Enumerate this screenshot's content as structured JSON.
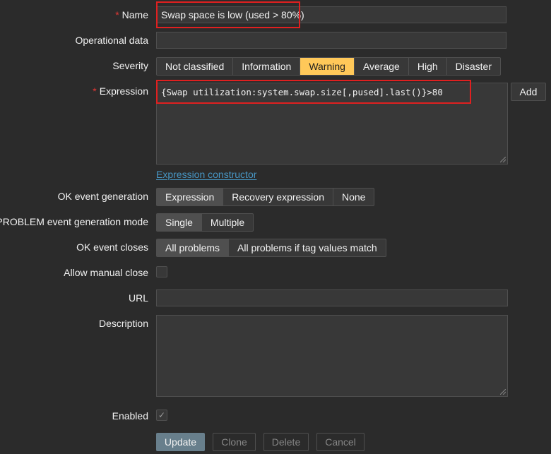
{
  "form": {
    "name": {
      "label": "Name",
      "required": "*",
      "value": "Swap space is low (used > 80%)"
    },
    "operational_data": {
      "label": "Operational data",
      "value": ""
    },
    "severity": {
      "label": "Severity",
      "options": [
        "Not classified",
        "Information",
        "Warning",
        "Average",
        "High",
        "Disaster"
      ],
      "selected": "Warning"
    },
    "expression": {
      "label": "Expression",
      "required": "*",
      "value": "{Swap utilization:system.swap.size[,pused].last()}>80",
      "add_label": "Add",
      "constructor_link": "Expression constructor"
    },
    "ok_event_generation": {
      "label": "OK event generation",
      "options": [
        "Expression",
        "Recovery expression",
        "None"
      ],
      "selected": "Expression"
    },
    "problem_mode": {
      "label": "PROBLEM event generation mode",
      "options": [
        "Single",
        "Multiple"
      ],
      "selected": "Single"
    },
    "ok_event_closes": {
      "label": "OK event closes",
      "options": [
        "All problems",
        "All problems if tag values match"
      ],
      "selected": "All problems"
    },
    "allow_manual_close": {
      "label": "Allow manual close",
      "checked": false
    },
    "url": {
      "label": "URL",
      "value": ""
    },
    "description": {
      "label": "Description",
      "value": ""
    },
    "enabled": {
      "label": "Enabled",
      "checked": true,
      "check_glyph": "✓"
    }
  },
  "buttons": {
    "update": "Update",
    "clone": "Clone",
    "delete": "Delete",
    "cancel": "Cancel"
  },
  "colors": {
    "background": "#2b2b2b",
    "field": "#383838",
    "warning": "#ffc859",
    "link": "#4796c4",
    "highlight": "#e02020",
    "required": "#e33734"
  }
}
